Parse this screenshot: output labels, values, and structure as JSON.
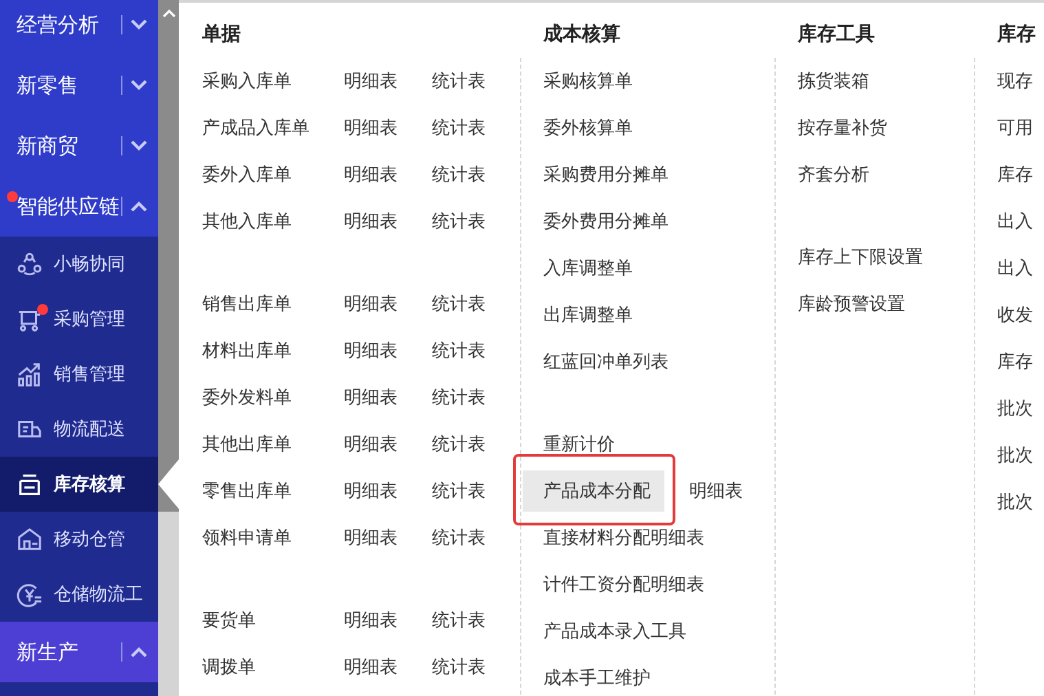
{
  "sidebar": {
    "sections": [
      {
        "label": "经营分析",
        "expanded": false,
        "badge": false,
        "hovered": false
      },
      {
        "label": "新零售",
        "expanded": false,
        "badge": false,
        "hovered": false
      },
      {
        "label": "新商贸",
        "expanded": false,
        "badge": false,
        "hovered": false
      },
      {
        "label": "智能供应链",
        "expanded": true,
        "badge": true,
        "hovered": false,
        "children": [
          {
            "label": "小畅协同",
            "kind": "network",
            "badge": false,
            "selected": false
          },
          {
            "label": "采购管理",
            "kind": "cart",
            "badge": true,
            "selected": false
          },
          {
            "label": "销售管理",
            "kind": "chart",
            "badge": false,
            "selected": false
          },
          {
            "label": "物流配送",
            "kind": "truck",
            "badge": false,
            "selected": false
          },
          {
            "label": "库存核算",
            "kind": "tray",
            "badge": false,
            "selected": true
          },
          {
            "label": "移动仓管",
            "kind": "warehouse",
            "badge": false,
            "selected": false
          },
          {
            "label": "仓储物流工",
            "kind": "yen",
            "badge": false,
            "selected": false
          }
        ]
      },
      {
        "label": "新生产",
        "expanded": true,
        "badge": false,
        "hovered": true
      }
    ]
  },
  "menu": {
    "columns": [
      {
        "title": "单据",
        "rows": [
          {
            "kind": "item",
            "label": "采购入库单",
            "links": [
              "明细表",
              "统计表"
            ]
          },
          {
            "kind": "item",
            "label": "产成品入库单",
            "links": [
              "明细表",
              "统计表"
            ]
          },
          {
            "kind": "item",
            "label": "委外入库单",
            "links": [
              "明细表",
              "统计表"
            ]
          },
          {
            "kind": "item",
            "label": "其他入库单",
            "links": [
              "明细表",
              "统计表"
            ]
          },
          {
            "kind": "spacer"
          },
          {
            "kind": "item",
            "label": "销售出库单",
            "links": [
              "明细表",
              "统计表"
            ]
          },
          {
            "kind": "item",
            "label": "材料出库单",
            "links": [
              "明细表",
              "统计表"
            ]
          },
          {
            "kind": "item",
            "label": "委外发料单",
            "links": [
              "明细表",
              "统计表"
            ]
          },
          {
            "kind": "item",
            "label": "其他出库单",
            "links": [
              "明细表",
              "统计表"
            ]
          },
          {
            "kind": "item",
            "label": "零售出库单",
            "links": [
              "明细表",
              "统计表"
            ]
          },
          {
            "kind": "item",
            "label": "领料申请单",
            "links": [
              "明细表",
              "统计表"
            ]
          },
          {
            "kind": "spacer"
          },
          {
            "kind": "item",
            "label": "要货单",
            "links": [
              "明细表",
              "统计表"
            ]
          },
          {
            "kind": "item",
            "label": "调拨单",
            "links": [
              "明细表",
              "统计表"
            ]
          }
        ]
      },
      {
        "title": "成本核算",
        "rows": [
          {
            "kind": "item",
            "label": "采购核算单"
          },
          {
            "kind": "item",
            "label": "委外核算单"
          },
          {
            "kind": "item",
            "label": "采购费用分摊单"
          },
          {
            "kind": "item",
            "label": "委外费用分摊单"
          },
          {
            "kind": "item",
            "label": "入库调整单"
          },
          {
            "kind": "item",
            "label": "出库调整单"
          },
          {
            "kind": "item",
            "label": "红蓝回冲单列表"
          },
          {
            "kind": "spacer"
          },
          {
            "kind": "item",
            "label": "重新计价"
          },
          {
            "kind": "item",
            "label": "产品成本分配",
            "links": [
              "明细表"
            ],
            "highlighted": true
          },
          {
            "kind": "item",
            "label": "直接材料分配明细表"
          },
          {
            "kind": "item",
            "label": "计件工资分配明细表"
          },
          {
            "kind": "item",
            "label": "产品成本录入工具"
          },
          {
            "kind": "item",
            "label": "成本手工维护"
          }
        ]
      },
      {
        "title": "库存工具",
        "rows": [
          {
            "kind": "item",
            "label": "拣货装箱"
          },
          {
            "kind": "item",
            "label": "按存量补货"
          },
          {
            "kind": "item",
            "label": "齐套分析"
          },
          {
            "kind": "spacer"
          },
          {
            "kind": "item",
            "label": "库存上下限设置"
          },
          {
            "kind": "item",
            "label": "库龄预警设置"
          }
        ]
      },
      {
        "title": "库存",
        "rows": [
          {
            "kind": "item",
            "label": "现存"
          },
          {
            "kind": "item",
            "label": "可用"
          },
          {
            "kind": "item",
            "label": "库存"
          },
          {
            "kind": "item",
            "label": "出入"
          },
          {
            "kind": "item",
            "label": "出入"
          },
          {
            "kind": "item",
            "label": "收发"
          },
          {
            "kind": "item",
            "label": "库存"
          },
          {
            "kind": "item",
            "label": "批次"
          },
          {
            "kind": "item",
            "label": "批次"
          },
          {
            "kind": "item",
            "label": "批次"
          }
        ]
      }
    ]
  }
}
